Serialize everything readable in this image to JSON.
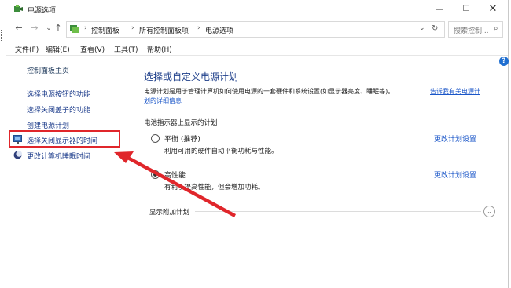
{
  "window": {
    "title": "电源选项",
    "minimize_glyph": "—",
    "maximize_glyph": "☐",
    "close_glyph": "✕"
  },
  "address": {
    "back_glyph": "←",
    "forward_glyph": "→",
    "history_glyph": "⌄",
    "up_glyph": "↑",
    "breadcrumbs": [
      "控制面板",
      "所有控制面板项",
      "电源选项"
    ],
    "separator": "›",
    "dropdown_glyph": "⌄",
    "refresh_glyph": "↻",
    "search_placeholder": "搜索控制...",
    "search_glyph": "⌕"
  },
  "menu": [
    "文件(F)",
    "编辑(E)",
    "查看(V)",
    "工具(T)",
    "帮助(H)"
  ],
  "sidebar": {
    "home_link": "控制面板主页",
    "links": [
      "选择电源按钮的功能",
      "选择关闭盖子的功能",
      "创建电源计划",
      "选择关闭显示器的时间",
      "更改计算机睡眠时间"
    ]
  },
  "main": {
    "heading": "选择或自定义电源计划",
    "description_line1": "电源计划是用于管理计算机如何使用电源的一套硬件和系统设置(如显示器亮度、睡眠等)。",
    "description_link1": "告诉我有关电源计",
    "description_link2": "划的详细信息",
    "section_title": "电池指示器上显示的计划",
    "plans": [
      {
        "name": "平衡 (推荐)",
        "description": "利用可用的硬件自动平衡功耗与性能。",
        "change_label": "更改计划设置",
        "selected": false
      },
      {
        "name": "高性能",
        "description": "有利于提高性能，但会增加功耗。",
        "change_label": "更改计划设置",
        "selected": true
      }
    ],
    "more_plans": "显示附加计划",
    "expand_glyph": "⌄",
    "help_glyph": "?"
  },
  "annotation": {
    "highlight_color": "#e0262b",
    "arrow_color": "#e0262b"
  }
}
